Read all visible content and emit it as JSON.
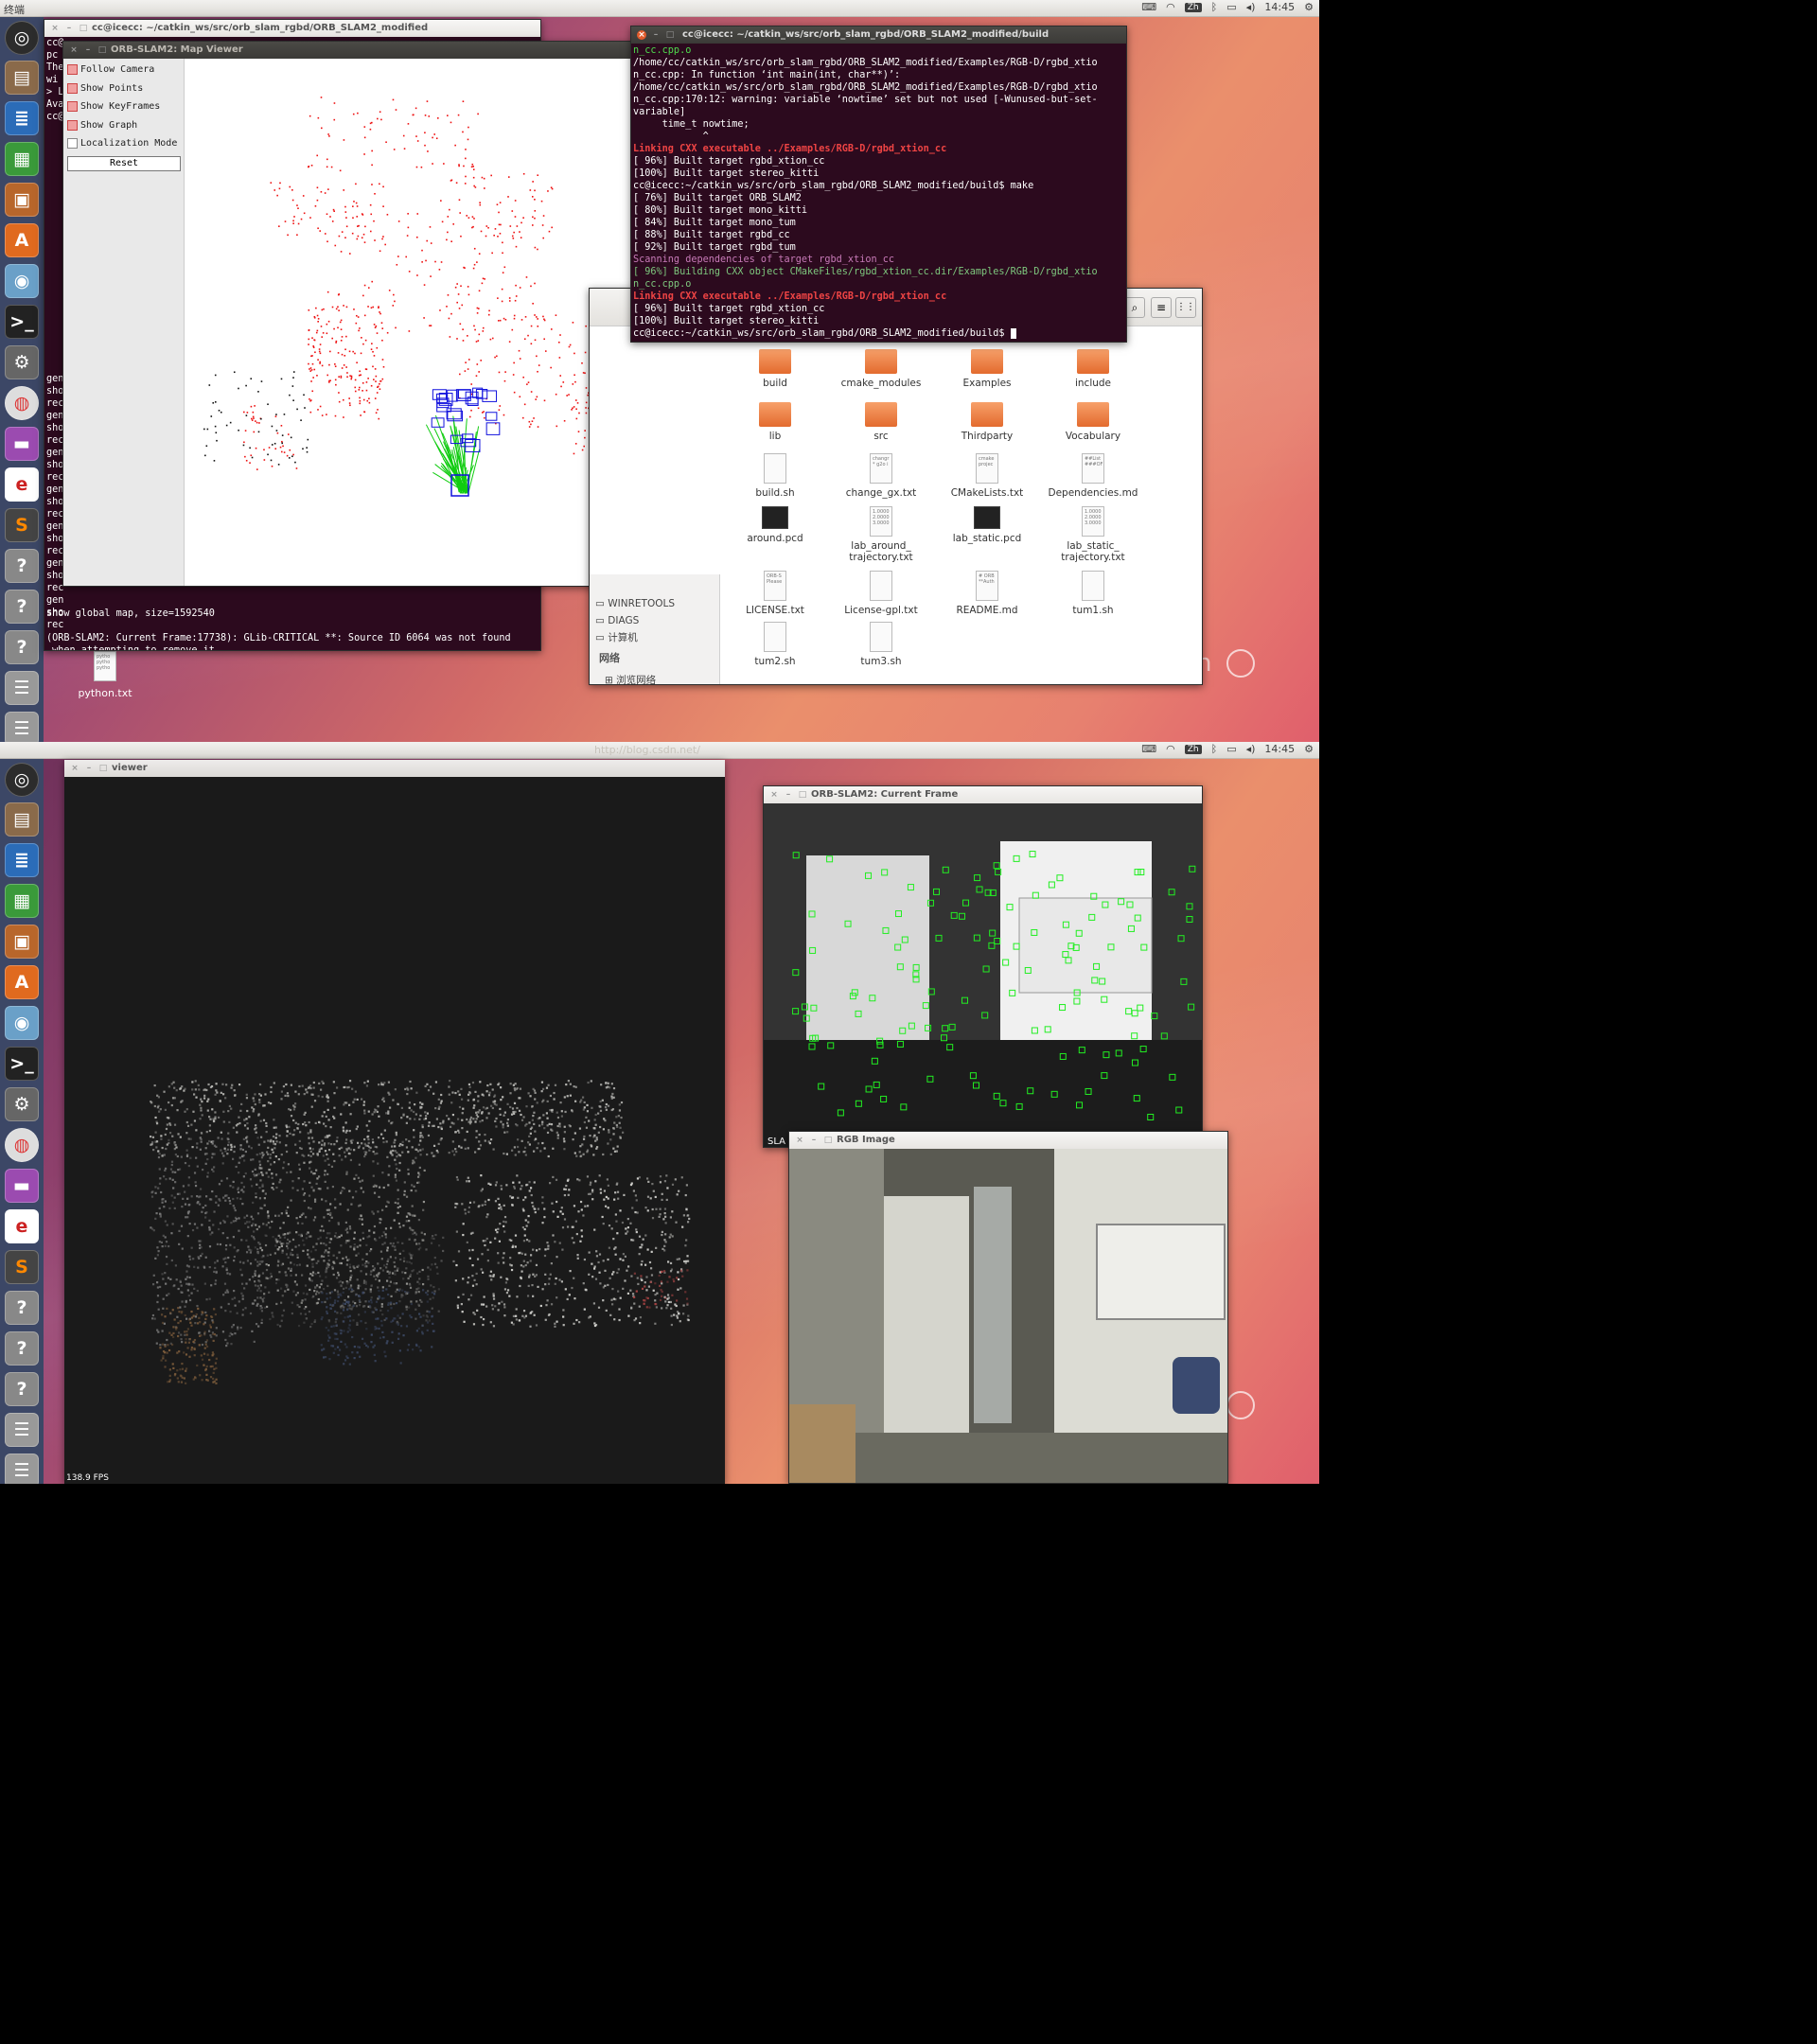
{
  "colors": {
    "wallpaper_start": "#6b2f58",
    "wallpaper_end": "#e7816f",
    "launcher": "#3c4766",
    "terminal_bg": "#2c0a1e",
    "terminal_green": "#4eda4e",
    "terminal_red": "#ef4444",
    "map_points": "#ff0000",
    "keyframes": "#0000ff",
    "graph": "#00ff00"
  },
  "top": {
    "menubar": {
      "title": "终端",
      "ime": "Zh",
      "time": "14:45",
      "tray_icons": [
        "keyboard-icon",
        "wifi-icon",
        "ime-icon",
        "bluetooth-icon",
        "battery-icon",
        "volume-icon"
      ]
    },
    "launcher_icons": [
      "ubuntu-dash-icon",
      "files-icon",
      "writer-icon",
      "calc-icon",
      "impress-icon",
      "software-center-icon",
      "disk-icon",
      "terminal-icon",
      "settings-icon",
      "chrome-icon",
      "purple-app-icon",
      "evince-icon",
      "sublime-icon",
      "unknown-app-icon",
      "unknown-app-icon",
      "unknown-app-icon",
      "trash-icon"
    ],
    "term_left": {
      "title": "cc@icecc: ~/catkin_ws/src/orb_slam_rgbd/ORB_SLAM2_modified",
      "top_lines": [
        "cc@",
        "pc",
        "The",
        "wi",
        "> L",
        "Ava",
        "cc@"
      ],
      "side_lines": [
        "gen",
        "sho",
        "rec",
        "gen",
        "sho",
        "rec",
        "gen",
        "sho",
        "rec",
        "gen",
        "sho",
        "rec",
        "gen",
        "sho",
        "rec",
        "gen",
        "sho",
        "rec",
        "gen",
        "sho",
        "rec"
      ],
      "bottom_lines": [
        "show global map, size=1592540",
        "",
        "(ORB-SLAM2: Current Frame:17738): GLib-CRITICAL **: Source ID 6064 was not found",
        " when attempting to remove it"
      ]
    },
    "map_viewer": {
      "title": "ORB-SLAM2: Map Viewer",
      "options": [
        {
          "label": "Follow Camera",
          "checked": true
        },
        {
          "label": "Show Points",
          "checked": true
        },
        {
          "label": "Show KeyFrames",
          "checked": true
        },
        {
          "label": "Show Graph",
          "checked": true
        },
        {
          "label": "Localization Mode",
          "checked": false
        }
      ],
      "reset": "Reset"
    },
    "term_build": {
      "title": "cc@icecc: ~/catkin_ws/src/orb_slam_rgbd/ORB_SLAM2_modified/build",
      "lines": [
        {
          "c": "g",
          "t": "n_cc.cpp.o"
        },
        {
          "c": "",
          "t": "/home/cc/catkin_ws/src/orb_slam_rgbd/ORB_SLAM2_modified/Examples/RGB-D/rgbd_xtio"
        },
        {
          "c": "",
          "t": "n_cc.cpp: In function ‘int main(int, char**)’:"
        },
        {
          "c": "",
          "t": "/home/cc/catkin_ws/src/orb_slam_rgbd/ORB_SLAM2_modified/Examples/RGB-D/rgbd_xtio"
        },
        {
          "c": "",
          "t": "n_cc.cpp:170:12: warning: variable ‘nowtime’ set but not used [-Wunused-but-set-"
        },
        {
          "c": "",
          "t": "variable]"
        },
        {
          "c": "",
          "t": "     time_t nowtime;"
        },
        {
          "c": "",
          "t": "            ^"
        },
        {
          "c": "r",
          "t": "Linking CXX executable ../Examples/RGB-D/rgbd_xtion_cc"
        },
        {
          "c": "",
          "t": "[ 96%] Built target rgbd_xtion_cc"
        },
        {
          "c": "",
          "t": "[100%] Built target stereo_kitti"
        },
        {
          "c": "",
          "t": "cc@icecc:~/catkin_ws/src/orb_slam_rgbd/ORB_SLAM2_modified/build$ make"
        },
        {
          "c": "",
          "t": "[ 76%] Built target ORB_SLAM2"
        },
        {
          "c": "",
          "t": "[ 80%] Built target mono_kitti"
        },
        {
          "c": "",
          "t": "[ 84%] Built target mono_tum"
        },
        {
          "c": "",
          "t": "[ 88%] Built target rgbd_cc"
        },
        {
          "c": "",
          "t": "[ 92%] Built target rgbd_tum"
        },
        {
          "c": "m",
          "t": "Scanning dependencies of target rgbd_xtion_cc"
        },
        {
          "c": "gr",
          "t": "[ 96%] Building CXX object CMakeFiles/rgbd_xtion_cc.dir/Examples/RGB-D/rgbd_xtio"
        },
        {
          "c": "gr",
          "t": "n_cc.cpp.o"
        },
        {
          "c": "r",
          "t": "Linking CXX executable ../Examples/RGB-D/rgbd_xtion_cc"
        },
        {
          "c": "",
          "t": "[ 96%] Built target rgbd_xtion_cc"
        },
        {
          "c": "",
          "t": "[100%] Built target stereo_kitti"
        },
        {
          "c": "",
          "t": "cc@icecc:~/catkin_ws/src/orb_slam_rgbd/ORB_SLAM2_modified/build$ "
        }
      ]
    },
    "file_manager": {
      "sidebar": [
        "WINRETOOLS",
        "DIAGS",
        "计算机"
      ],
      "sidebar_header": "网络",
      "sidebar_link": "浏览网络",
      "items": [
        {
          "name": "build",
          "kind": "folder"
        },
        {
          "name": "cmake_modules",
          "kind": "folder"
        },
        {
          "name": "Examples",
          "kind": "folder"
        },
        {
          "name": "include",
          "kind": "folder"
        },
        {
          "name": "lib",
          "kind": "folder"
        },
        {
          "name": "src",
          "kind": "folder"
        },
        {
          "name": "Thirdparty",
          "kind": "folder"
        },
        {
          "name": "Vocabulary",
          "kind": "folder"
        },
        {
          "name": "build.sh",
          "kind": "doc"
        },
        {
          "name": "change_gx.txt",
          "kind": "doc",
          "preview": "changr * g2o i"
        },
        {
          "name": "CMakeLists.txt",
          "kind": "doc",
          "preview": "cmake projec"
        },
        {
          "name": "Dependencies.md",
          "kind": "doc",
          "preview": "##List ###OF"
        },
        {
          "name": "around.pcd",
          "kind": "dark"
        },
        {
          "name": "lab_around_ trajectory.txt",
          "kind": "doc",
          "preview": "1.0000 2.0000 3.0000"
        },
        {
          "name": "lab_static.pcd",
          "kind": "dark"
        },
        {
          "name": "lab_static_ trajectory.txt",
          "kind": "doc",
          "preview": "1.0000 2.0000 3.0000"
        },
        {
          "name": "LICENSE.txt",
          "kind": "doc",
          "preview": "ORB-S Please"
        },
        {
          "name": "License-gpl.txt",
          "kind": "doc"
        },
        {
          "name": "README.md",
          "kind": "doc",
          "preview": "# ORB **Auth"
        },
        {
          "name": "tum1.sh",
          "kind": "doc"
        },
        {
          "name": "tum2.sh",
          "kind": "doc"
        },
        {
          "name": "tum3.sh",
          "kind": "doc"
        }
      ]
    },
    "desktop_file": {
      "label": "python.txt",
      "preview": "pytho pytho pytho"
    }
  },
  "bottom": {
    "watermark": "http://blog.csdn.net/",
    "viewer": {
      "title": "viewer",
      "fps": "138.9 FPS"
    },
    "current_frame": {
      "title": "ORB-SLAM2: Current Frame",
      "partial_label": "SLA"
    },
    "rgb": {
      "title": "RGB Image"
    }
  }
}
